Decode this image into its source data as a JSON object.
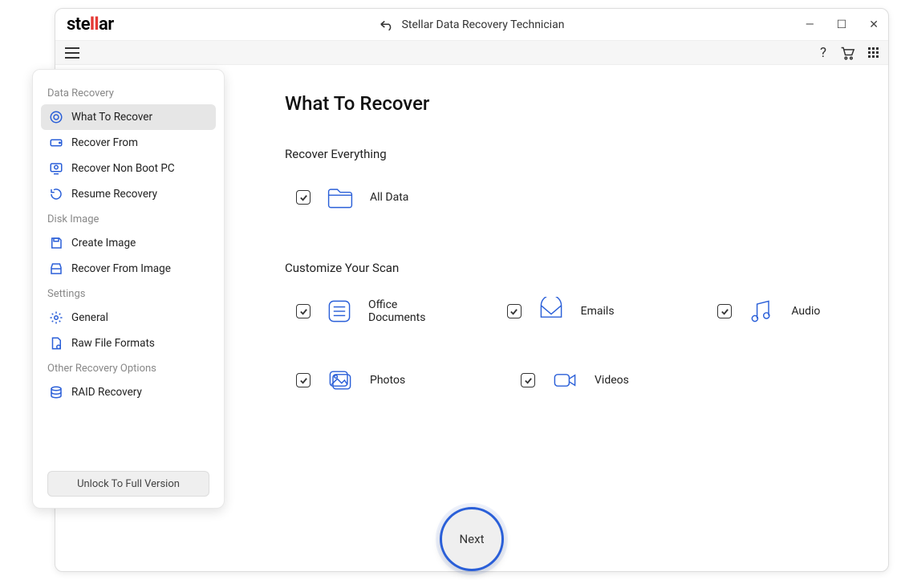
{
  "window": {
    "app_name_prefix": "ste",
    "app_name_accent": "ll",
    "app_name_suffix": "ar",
    "title": "Stellar Data Recovery Technician"
  },
  "sidebar": {
    "groups": [
      {
        "title": "Data Recovery",
        "items": [
          {
            "label": "What To Recover",
            "active": true
          },
          {
            "label": "Recover From"
          },
          {
            "label": "Recover Non Boot PC"
          },
          {
            "label": "Resume Recovery"
          }
        ]
      },
      {
        "title": "Disk Image",
        "items": [
          {
            "label": "Create Image"
          },
          {
            "label": "Recover From Image"
          }
        ]
      },
      {
        "title": "Settings",
        "items": [
          {
            "label": "General"
          },
          {
            "label": "Raw File Formats"
          }
        ]
      },
      {
        "title": "Other Recovery Options",
        "items": [
          {
            "label": "RAID Recovery"
          }
        ]
      }
    ],
    "unlock_label": "Unlock To Full Version"
  },
  "main": {
    "heading": "What To Recover",
    "section1_title": "Recover Everything",
    "all_data_label": "All Data",
    "section2_title": "Customize Your Scan",
    "options": {
      "office": "Office Documents",
      "emails": "Emails",
      "audio": "Audio",
      "photos": "Photos",
      "videos": "Videos"
    },
    "next_label": "Next"
  }
}
